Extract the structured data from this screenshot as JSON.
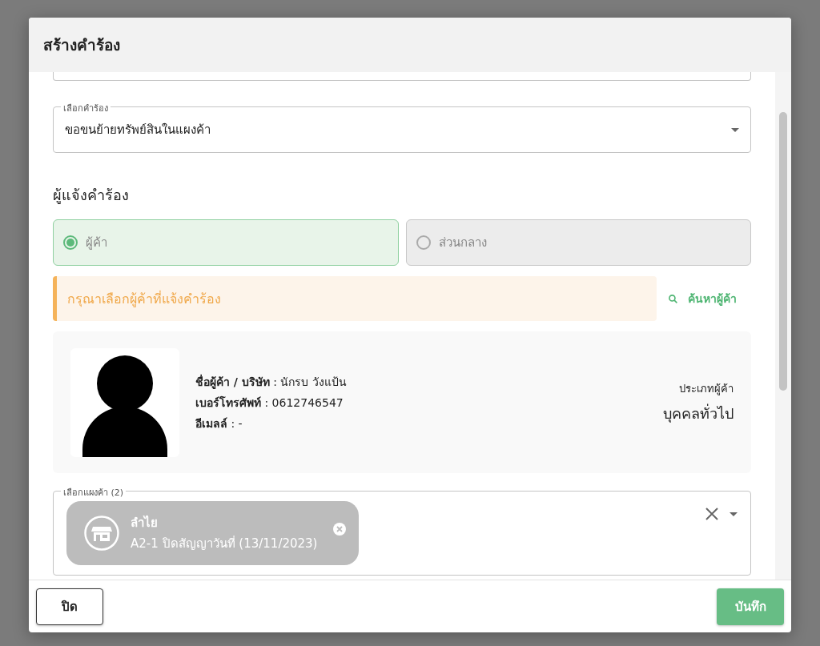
{
  "dialog": {
    "title": "สร้างคำร้อง"
  },
  "request_select": {
    "label": "เลือกคำร้อง",
    "value": "ขอขนย้ายทรัพย์สินในแผงค้า"
  },
  "requester": {
    "heading": "ผู้แจ้งคำร้อง",
    "options": [
      {
        "label": "ผู้ค้า",
        "selected": true
      },
      {
        "label": "ส่วนกลาง",
        "selected": false
      }
    ]
  },
  "alert": {
    "text": "กรุณาเลือกผู้ค้าที่แจ้งคำร้อง"
  },
  "search_link": "ค้นหาผู้ค้า",
  "vendor": {
    "fields": [
      "**ชื่อผู้ค้า / บริษัท** : นักรบ วังแป้น",
      "**เบอร์โทรศัพท์** : 0612746547",
      "**อีเมลล์** : -"
    ],
    "type_label": "ประเภทผู้ค้า",
    "type_value": "บุคคลทั่วไป"
  },
  "stall_select": {
    "label": "เลือกแผงค้า (2)",
    "chips": [
      {
        "title": "ลำไย",
        "subtitle": "A2-1 ปิดสัญญาวันที่ (13/11/2023)"
      }
    ]
  },
  "buttons": [
    {
      "label": "ปิด",
      "kind": "outline"
    },
    {
      "label": "บันทึก",
      "kind": "primary"
    }
  ]
}
